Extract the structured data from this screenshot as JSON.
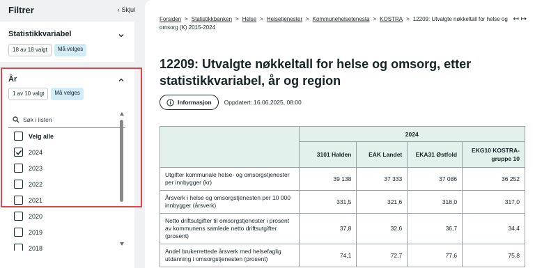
{
  "sidebar": {
    "title": "Filtrer",
    "hide_label": "Skjul",
    "stat_var": {
      "title": "Statistikkvariabel",
      "selected": "18 av 18 valgt",
      "required": "Må velges"
    },
    "year": {
      "title": "År",
      "selected": "1 av 10 valgt",
      "required": "Må velges",
      "search_placeholder": "Søk i listen",
      "options": [
        {
          "label": "Velg alle",
          "checked": false
        },
        {
          "label": "2024",
          "checked": true
        },
        {
          "label": "2023",
          "checked": false
        },
        {
          "label": "2022",
          "checked": false
        },
        {
          "label": "2021",
          "checked": false
        },
        {
          "label": "2020",
          "checked": false
        },
        {
          "label": "2019",
          "checked": false
        },
        {
          "label": "2018",
          "checked": false
        }
      ]
    }
  },
  "breadcrumb": {
    "items": [
      "Forsiden",
      "Statistikkbanken",
      "Helse",
      "Helsetjenester",
      "Kommunehelsetenesta",
      "KOSTRA"
    ],
    "current": "12209: Utvalgte nøkkeltall for helse og omsorg (K) 2015-2024"
  },
  "page": {
    "title": "12209: Utvalgte nøkkeltall for helse og omsorg, etter statistikkvariabel, år og region",
    "info_label": "Informasjon",
    "updated": "Oppdatert: 16.06.2025, 08:00"
  },
  "table": {
    "year": "2024",
    "columns": [
      "3101 Halden",
      "EAK Landet",
      "EKA31 Østfold",
      "EKG10 KOSTRA-gruppe 10"
    ],
    "rows": [
      {
        "label": "Utgifter kommunale helse- og omsorgstjenester per innbygger (kr)",
        "values": [
          "39 138",
          "37 333",
          "37 086",
          "36 252"
        ]
      },
      {
        "label": "Årsverk i helse og omsorgstjenesten per 10 000 innbygger (årsverk)",
        "values": [
          "331,5",
          "321,6",
          "318,0",
          "317,0"
        ]
      },
      {
        "label": "Netto driftsutgifter til omsorgstjenester i prosent av kommunens samlede netto driftsutgifter (prosent)",
        "values": [
          "37,8",
          "32,6",
          "36,7",
          "34,4"
        ]
      },
      {
        "label": "Andel brukerrettede årsverk med helsefaglig utdanning i omsorgstjenesten (prosent)",
        "values": [
          "74,1",
          "72,7",
          "77,6",
          "75,8"
        ]
      }
    ]
  },
  "colors": {
    "highlight": "#e2424a",
    "required_badge": "#d2ecf7",
    "table_header": "#e3f1ec"
  }
}
